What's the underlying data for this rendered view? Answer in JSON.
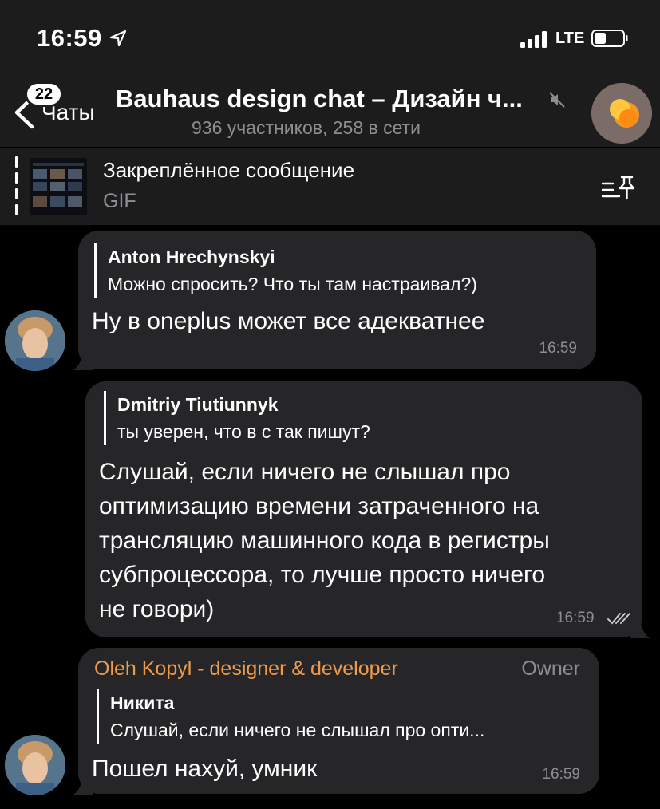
{
  "status_bar": {
    "time": "16:59",
    "network": "LTE",
    "icons": [
      "location-arrow-icon",
      "signal-icon",
      "battery-icon"
    ]
  },
  "header": {
    "back_label": "Чаты",
    "unread_badge": "22",
    "title": "Bauhaus design chat – Дизайн ч...",
    "subtitle": "936 участников, 258 в сети",
    "muted": true
  },
  "pinned": {
    "title": "Закреплённое сообщение",
    "subtitle": "GIF"
  },
  "messages": [
    {
      "reply_name": "Anton Hrechynskyi",
      "reply_text": "Можно спросить? Что ты там настраивал?)",
      "text": "Ну в oneplus может все адекватнее",
      "time": "16:59"
    },
    {
      "reply_name": "Dmitriy Tiutiunnyk",
      "reply_text": "ты уверен, что в с так пишут?",
      "lines": [
        "Слушай, если ничего не слышал про",
        "оптимизацию времени затраченного на",
        "трансляцию машинного кода в регистры",
        "субпроцессора, то лучше просто ничего",
        "не говори)"
      ],
      "time": "16:59",
      "status": "read"
    },
    {
      "sender": "Oleh Kopyl - designer & developer",
      "sender_role": "Owner",
      "reply_name": "Никита",
      "reply_text": "Слушай, если ничего не слышал про опти...",
      "text": "Пошел нахуй, умник",
      "time": "16:59"
    }
  ],
  "colors": {
    "background": "#000000",
    "header": "#1c1c1d",
    "bubble": "#262628",
    "secondary_text": "#8d8e93",
    "sender_accent": "#f09a4a"
  }
}
